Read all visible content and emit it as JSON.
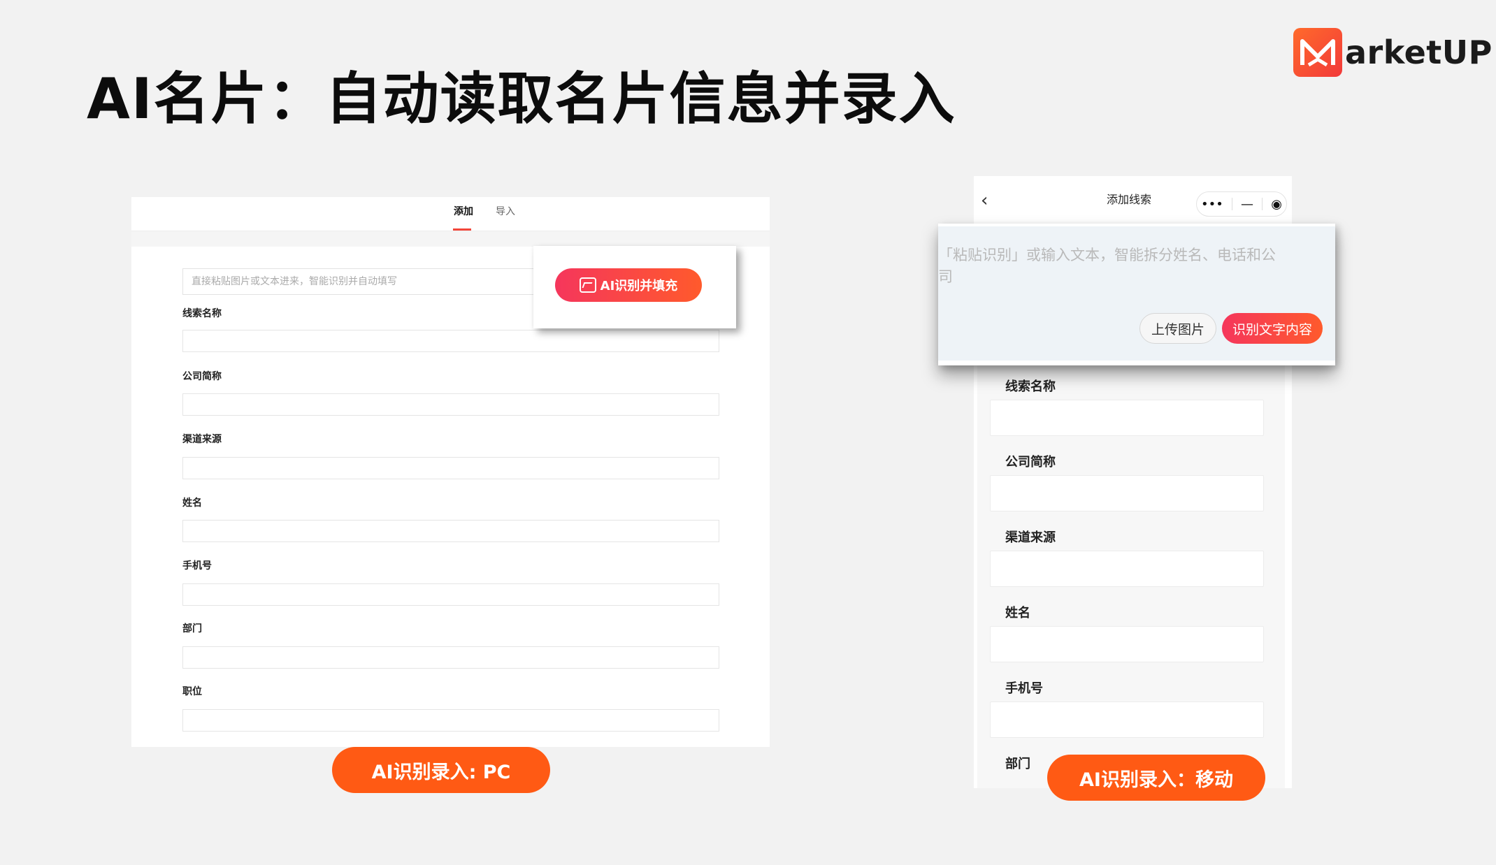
{
  "slide": {
    "title": "AI名片：自动读取名片信息并录入",
    "brand_text": "arketUP"
  },
  "pc": {
    "tabs": [
      "添加",
      "导入"
    ],
    "active_tab": "添加",
    "paste_placeholder": "直接粘贴图片或文本进来，智能识别并自动填写",
    "ai_button": "AI识别并填充",
    "fields": [
      "线索名称",
      "公司简称",
      "渠道来源",
      "姓名",
      "手机号",
      "部门",
      "职位"
    ],
    "caption": "AI识别录入: PC"
  },
  "mobile": {
    "nav_title": "添加线索",
    "back_icon": "chevron-left-icon",
    "capsule_icons": [
      "more-dots-icon",
      "minimize-icon",
      "target-icon"
    ],
    "ai_hint": "「粘贴识别」或输入文本，智能拆分姓名、电话和公司",
    "upload_button": "上传图片",
    "recognize_button": "识别文字内容",
    "fields": [
      "线索名称",
      "公司简称",
      "渠道来源",
      "姓名",
      "手机号",
      "部门"
    ],
    "caption": "AI识别录入：移动"
  },
  "colors": {
    "accent": "#ff5a14",
    "gradient_start": "#f5365c",
    "gradient_end": "#ff5a2c",
    "tab_underline": "#f2463a"
  }
}
